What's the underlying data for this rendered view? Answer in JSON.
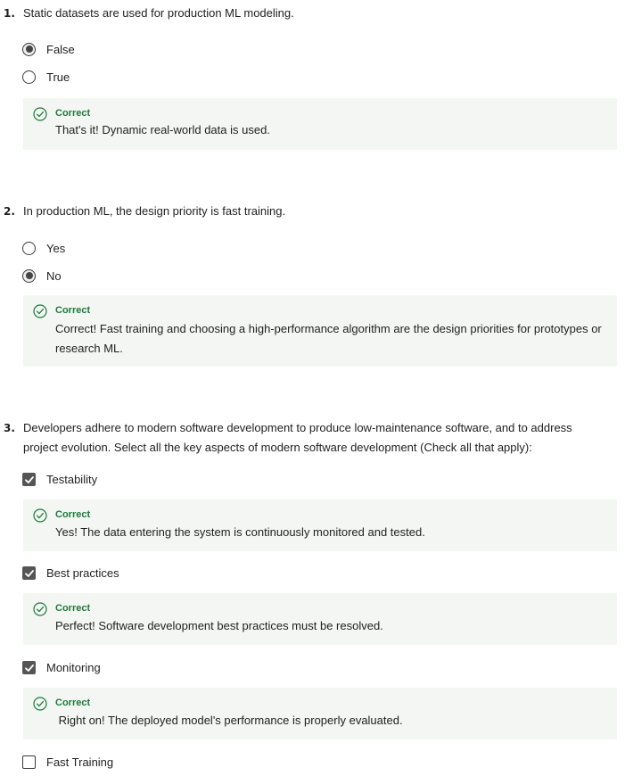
{
  "questions": [
    {
      "number": "1.",
      "text": "Static datasets are used for production ML modeling.",
      "type": "radio",
      "options": [
        {
          "label": "False",
          "checked": true
        },
        {
          "label": "True",
          "checked": false
        }
      ],
      "feedback": {
        "title": "Correct",
        "text": "That's it! Dynamic real-world data is used."
      }
    },
    {
      "number": "2.",
      "text": "In production ML, the design priority is fast training.",
      "type": "radio",
      "options": [
        {
          "label": "Yes",
          "checked": false
        },
        {
          "label": "No",
          "checked": true
        }
      ],
      "feedback": {
        "title": "Correct",
        "text": "Correct! Fast training and choosing a high-performance algorithm are the design priorities for prototypes or research ML."
      }
    },
    {
      "number": "3.",
      "text": "Developers adhere to modern software development to produce low-maintenance software, and to address project evolution. Select all the key aspects of modern software development (Check all that apply):",
      "type": "checkbox",
      "options": [
        {
          "label": "Testability",
          "checked": true,
          "feedback": {
            "title": "Correct",
            "text": "Yes! The data entering the system is continuously monitored and tested."
          }
        },
        {
          "label": "Best practices",
          "checked": true,
          "feedback": {
            "title": "Correct",
            "text": "Perfect! Software development best practices must be resolved."
          }
        },
        {
          "label": "Monitoring",
          "checked": true,
          "feedback": {
            "title": "Correct",
            "text": " Right on! The deployed model's performance is properly evaluated."
          }
        },
        {
          "label": "Fast Training",
          "checked": false
        }
      ]
    }
  ],
  "colors": {
    "correct_green": "#1e7a3c",
    "feedback_bg": "#f3f6f3",
    "control_dark": "#555555"
  },
  "icons": {
    "feedback": "check-circle-icon",
    "checkbox": "checkmark-icon"
  }
}
